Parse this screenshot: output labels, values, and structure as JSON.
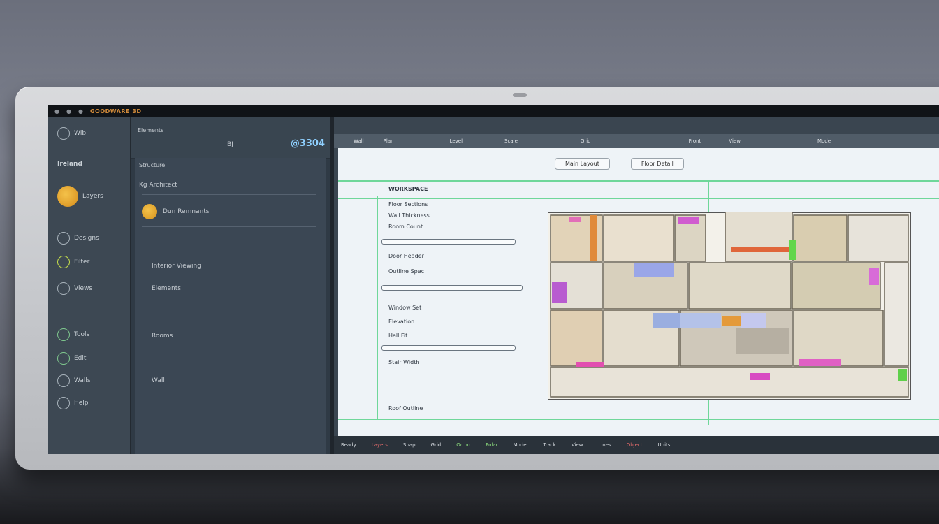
{
  "window": {
    "title": "GOODWARE 3D",
    "top_dots": [
      "●",
      "●",
      "●"
    ]
  },
  "nav": {
    "header": "Wlb",
    "brand": "Ireland",
    "items": [
      {
        "label": "Layers",
        "icon": "gold-badge-icon"
      },
      {
        "label": "Designs",
        "icon": "shield-icon"
      },
      {
        "label": "Filter",
        "icon": "leaf-icon"
      },
      {
        "label": "Views",
        "icon": "globe-icon"
      },
      {
        "label": "Tools",
        "icon": "green-circle-icon"
      },
      {
        "label": "Edit",
        "icon": "globe-icon"
      },
      {
        "label": "Walls",
        "icon": "globe-icon"
      },
      {
        "label": "Help",
        "icon": "globe-icon"
      }
    ]
  },
  "panel": {
    "path": "Elements",
    "code": "BJ",
    "zoom": "@3304",
    "tab_hint": "Structure",
    "section_title": "Kg Architect",
    "user_name": "Dun Remnants",
    "row1": "Interior Viewing",
    "row2": "Elements",
    "row3": "Rooms",
    "row4": "Wall"
  },
  "drawing": {
    "ruler_labels": [
      "Wall",
      "Plan",
      "Level",
      "Scale",
      "Grid",
      "Front",
      "View",
      "Mode"
    ],
    "tabs": [
      "Main Layout",
      "Floor Detail"
    ],
    "title": "WORKSPACE",
    "notes": [
      "Floor Sections",
      "Wall Thickness",
      "Room Count",
      "Door Header",
      "Outline Spec",
      "Window Set",
      "Elevation",
      "Hall Fit",
      "Stair Width",
      "Roof Outline"
    ]
  },
  "status": {
    "items": [
      "Ready",
      "Layers",
      "Snap",
      "Grid",
      "Ortho",
      "Polar",
      "Model",
      "Track",
      "View",
      "Lines",
      "Object",
      "Units"
    ]
  },
  "colors": {
    "nav_bg": "#3d4853",
    "panel_bg": "#2f3a45",
    "canvas_bg": "#eef3f7",
    "guide": "#6fd79a",
    "accent_gold": "#e0a52b"
  }
}
